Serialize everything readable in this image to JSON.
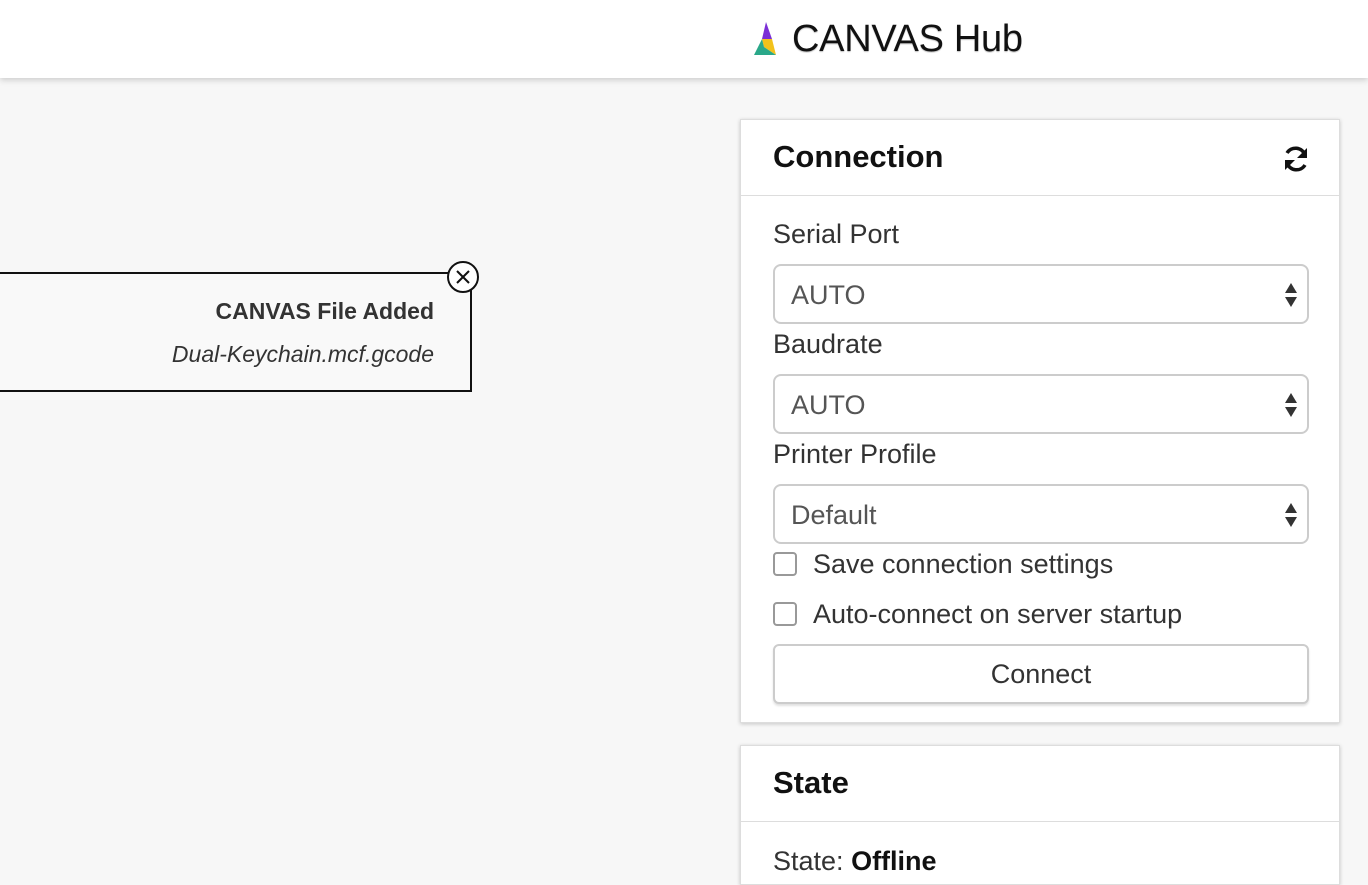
{
  "header": {
    "title": "CANVAS Hub",
    "logo_icon": "canvas-triangle-logo",
    "colors": {
      "logo_purple": "#7b2fd6",
      "logo_yellow": "#f2c21b",
      "logo_teal": "#2aa889"
    }
  },
  "notification": {
    "title": "CANVAS File Added",
    "filename": "Dual-Keychain.mcf.gcode",
    "close_icon": "close-circle-icon"
  },
  "connection_panel": {
    "title": "Connection",
    "refresh_icon": "refresh-icon",
    "serial_port": {
      "label": "Serial Port",
      "value": "AUTO"
    },
    "baudrate": {
      "label": "Baudrate",
      "value": "AUTO"
    },
    "printer_profile": {
      "label": "Printer Profile",
      "value": "Default"
    },
    "save_settings": {
      "label": "Save connection settings",
      "checked": false
    },
    "auto_connect": {
      "label": "Auto-connect on server startup",
      "checked": false
    },
    "connect_button": "Connect"
  },
  "state_panel": {
    "title": "State",
    "state_label": "State:",
    "state_value": "Offline"
  }
}
